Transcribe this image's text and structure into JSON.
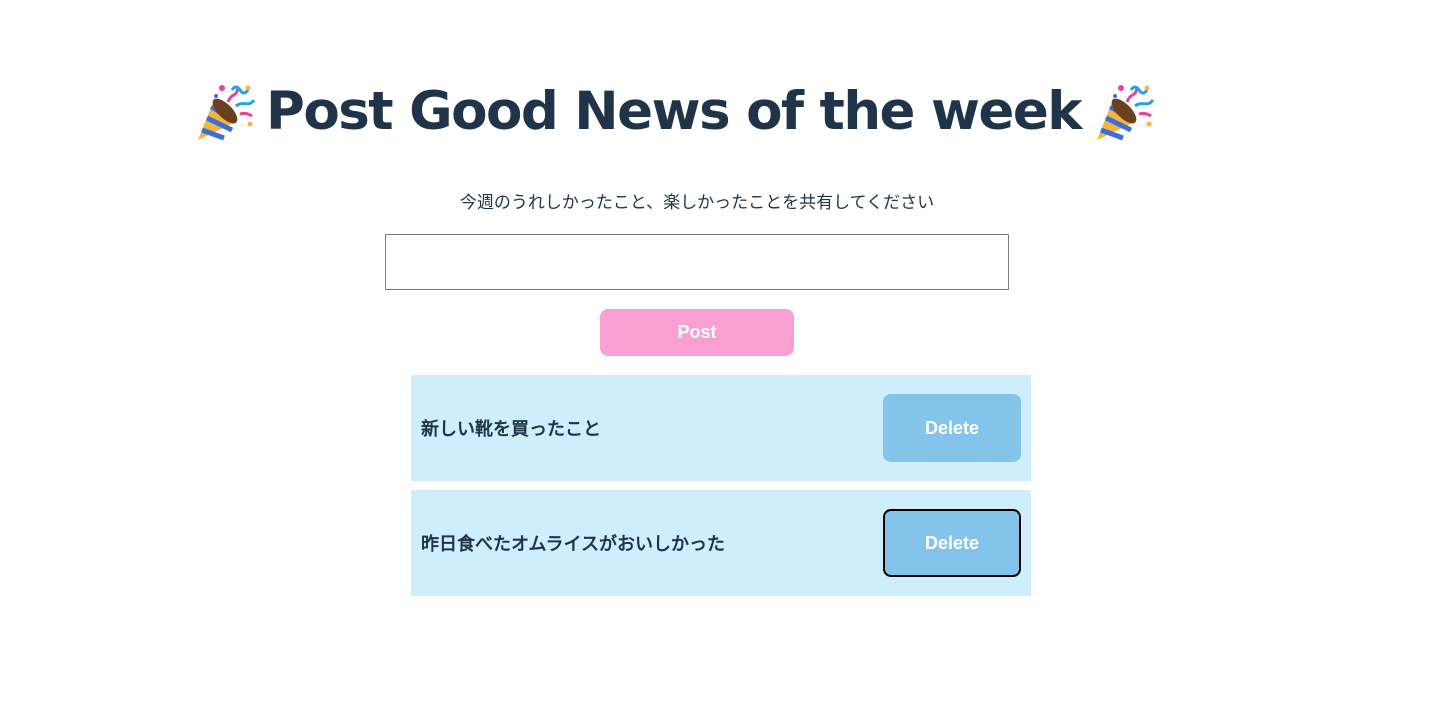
{
  "header": {
    "title": "Post Good News of the week",
    "left_icon": "party-popper-icon",
    "right_icon": "party-popper-icon"
  },
  "subtitle": "今週のうれしかったこと、楽しかったことを共有してください",
  "form": {
    "input_value": "",
    "input_placeholder": "",
    "post_label": "Post"
  },
  "posts": [
    {
      "text": "新しい靴を買ったこと",
      "delete_label": "Delete"
    },
    {
      "text": "昨日食べたオムライスがおいしかった",
      "delete_label": "Delete"
    }
  ],
  "colors": {
    "title": "#1f3349",
    "post_button": "#f9a0d2",
    "item_background": "#cdeefa",
    "delete_button": "#84c4ea"
  }
}
